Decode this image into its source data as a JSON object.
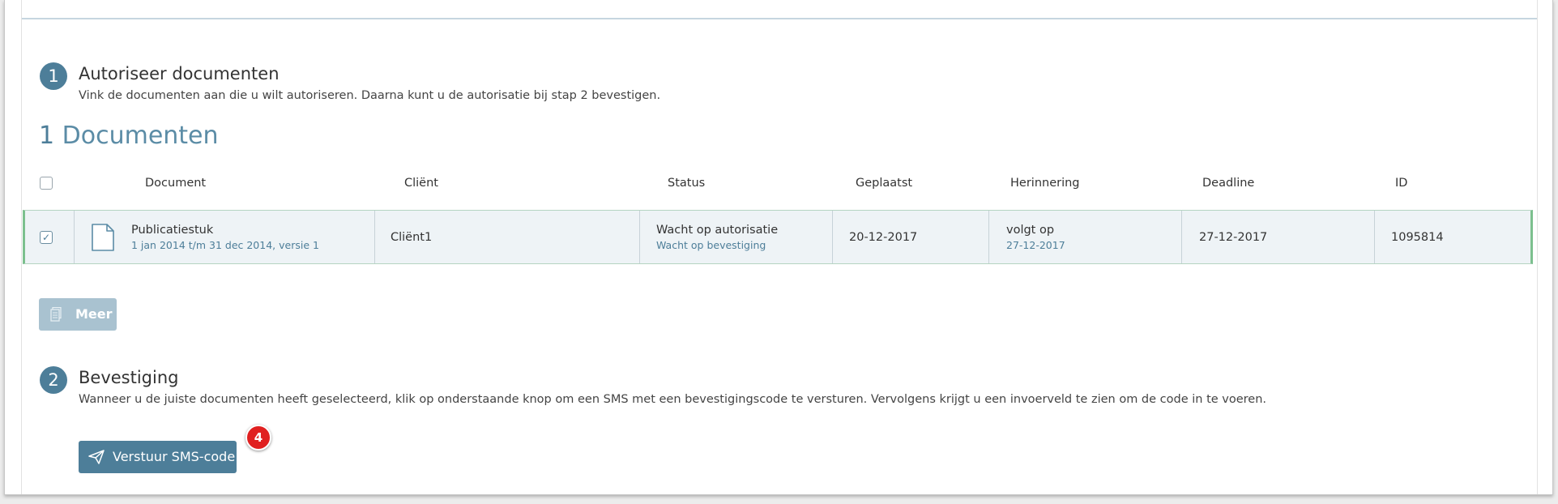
{
  "step1": {
    "number": "1",
    "title": "Autoriseer documenten",
    "description": "Vink de documenten aan die u wilt autoriseren. Daarna kunt u de autorisatie bij stap 2 bevestigen."
  },
  "documents_count": {
    "count": "1",
    "label": "Documenten"
  },
  "table": {
    "headers": {
      "document": "Document",
      "client": "Cliënt",
      "status": "Status",
      "placed": "Geplaatst",
      "reminder": "Herinnering",
      "deadline": "Deadline",
      "id": "ID"
    },
    "rows": [
      {
        "checked": true,
        "document_name": "Publicatiestuk",
        "document_sub": "1 jan 2014 t/m 31 dec 2014, versie 1",
        "client": "Cliënt1",
        "status": "Wacht op autorisatie",
        "status_sub": "Wacht op bevestiging",
        "placed": "20-12-2017",
        "reminder": "volgt op",
        "reminder_sub": "27-12-2017",
        "deadline": "27-12-2017",
        "id": "1095814"
      }
    ]
  },
  "more_button": {
    "label": "Meer",
    "icon": "document-stack-icon"
  },
  "step2": {
    "number": "2",
    "title": "Bevestiging",
    "description": "Wanneer u de juiste documenten heeft geselecteerd, klik op onderstaande knop om een SMS met een bevestigingscode te versturen. Vervolgens krijgt u een invoerveld te zien om de code in te voeren."
  },
  "sms_button": {
    "label": "Verstuur SMS-code",
    "icon": "paper-plane-icon"
  },
  "annotation_badge": "4",
  "colors": {
    "accent": "#4d7e99",
    "row_border": "#7cc08e",
    "badge": "#e02020",
    "button_disabled": "#a9c2d0"
  }
}
